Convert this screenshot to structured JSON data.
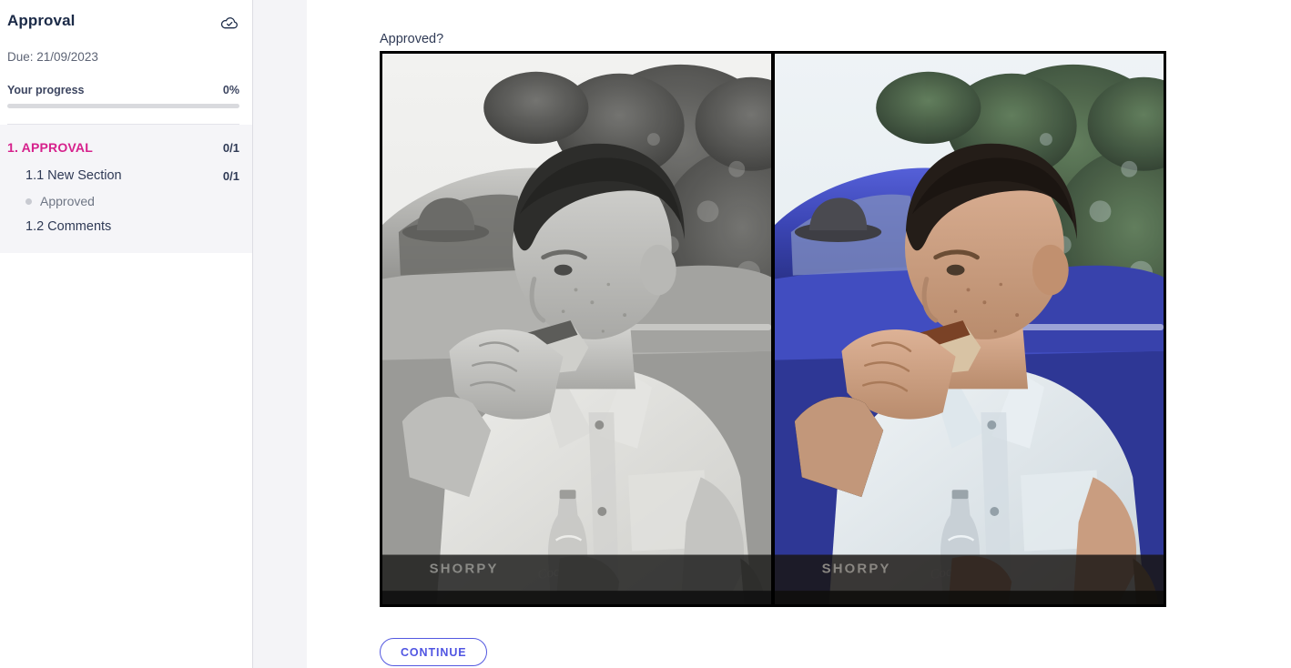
{
  "sidebar": {
    "title": "Approval",
    "sync_icon": "cloud-done-icon",
    "due": "Due: 21/09/2023",
    "progress_label": "Your progress",
    "progress_percent": "0%",
    "progress_value": 0,
    "nav": [
      {
        "level": 1,
        "label": "1. APPROVAL",
        "count": "0/1"
      },
      {
        "level": 2,
        "label": "1.1 New Section",
        "count": "0/1"
      },
      {
        "level": 3,
        "label": "Approved",
        "count": ""
      },
      {
        "level": 2,
        "label": "1.2 Comments",
        "count": ""
      }
    ]
  },
  "main": {
    "question": "Approved?",
    "image": {
      "alt": "Side-by-side comparison: black-and-white vintage photo of a young man eating a sandwich beside a car, and its colorized version",
      "left_watermark": "SHORPY",
      "right_watermark": "SHORPY",
      "colors": {
        "car_blue": "#3b45b4",
        "foliage_green": "#49604a",
        "sky": "#e8eef2",
        "skin": "#cfa88c",
        "shirt": "#e6ebef"
      }
    },
    "continue_label": "CONTINUE"
  },
  "theme": {
    "accent_pink": "#d6218c",
    "accent_blue": "#5358e0",
    "text_dark": "#2f3a55",
    "text_muted": "#6f7685",
    "panel_gray": "#f5f5f8",
    "gutter_gray": "#f4f4f7"
  }
}
